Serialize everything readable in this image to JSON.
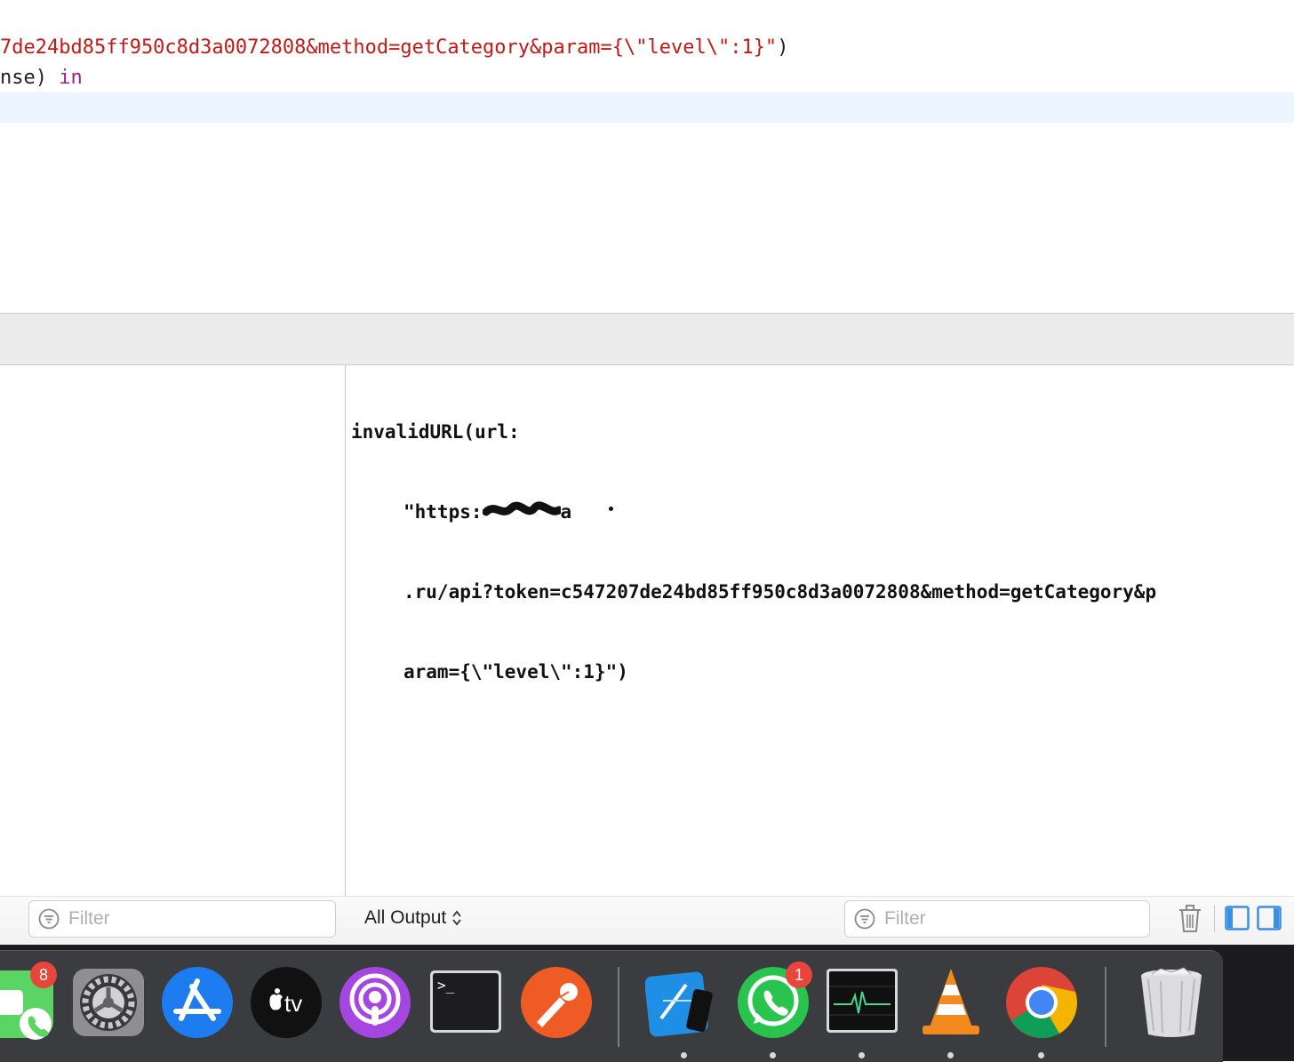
{
  "editor": {
    "line1": {
      "string_part": "7de24bd85ff950c8d3a0072808&method=getCategory&param={\\\"level\\\":1}\"",
      "closing": ")"
    },
    "line2": {
      "text": "nse) ",
      "keyword": "in"
    }
  },
  "console": {
    "line1": "invalidURL(url:",
    "line2_prefix": "\"https:",
    "line2_suffix": "a",
    "line3": ".ru/api?token=c547207de24bd85ff950c8d3a0072808&method=getCategory&p",
    "line4": "aram={\\\"level\\\":1}\")"
  },
  "bottom_bar": {
    "left_filter_placeholder": "Filter",
    "output_selector": "All Output",
    "right_filter_placeholder": "Filter"
  },
  "dock": {
    "facetime_badge": "8",
    "whatsapp_badge": "1",
    "terminal_prompt": ">_",
    "apple_tv_label": "tv",
    "apps": [
      "FaceTime",
      "System Preferences",
      "App Store",
      "Apple TV",
      "Podcasts",
      "Terminal",
      "Postman",
      "Xcode",
      "WhatsApp",
      "Activity Monitor",
      "VLC",
      "Google Chrome",
      "Trash"
    ]
  },
  "colors": {
    "string": "#c41a16",
    "keyword": "#9b2393",
    "current_line_highlight": "#ecf5ff",
    "accent_blue": "#3a8ee6"
  }
}
